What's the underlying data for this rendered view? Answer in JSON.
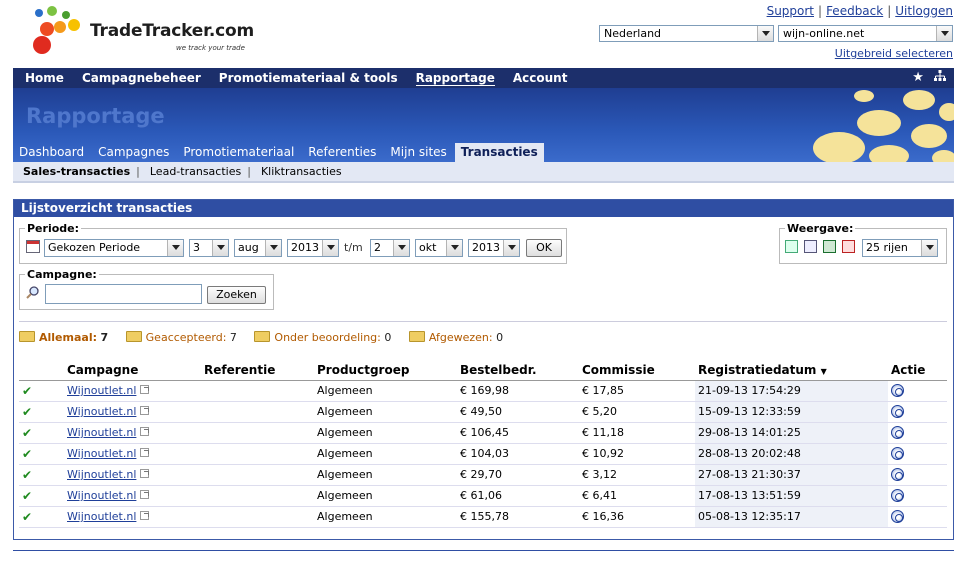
{
  "brand": {
    "name": "TradeTracker.com",
    "tagline": "we track your trade"
  },
  "top_links": [
    "Support",
    "Feedback",
    "Uitloggen"
  ],
  "country_select": {
    "value": "Nederland"
  },
  "site_select": {
    "value": "wijn-online.net"
  },
  "advanced_link": "Uitgebreid selecteren",
  "main_nav": [
    {
      "label": "Home",
      "active": false
    },
    {
      "label": "Campagnebeheer",
      "active": false
    },
    {
      "label": "Promotiemateriaal & tools",
      "active": false
    },
    {
      "label": "Rapportage",
      "active": true
    },
    {
      "label": "Account",
      "active": false
    }
  ],
  "main_nav_icons": [
    "star-icon",
    "sitemap-icon"
  ],
  "banner_title": "Rapportage",
  "sub_tabs": [
    {
      "label": "Dashboard",
      "active": false
    },
    {
      "label": "Campagnes",
      "active": false
    },
    {
      "label": "Promotiemateriaal",
      "active": false
    },
    {
      "label": "Referenties",
      "active": false
    },
    {
      "label": "Mijn sites",
      "active": false
    },
    {
      "label": "Transacties",
      "active": true
    }
  ],
  "sub_nav": [
    {
      "label": "Sales-transacties",
      "active": true
    },
    {
      "label": "Lead-transacties",
      "active": false
    },
    {
      "label": "Kliktransacties",
      "active": false
    }
  ],
  "panel": {
    "title": "Lijstoverzicht transacties",
    "periode": {
      "legend": "Periode:",
      "preset": "Gekozen Periode",
      "from_day": "3",
      "from_month": "aug",
      "from_year": "2013",
      "separator": "t/m",
      "to_day": "2",
      "to_month": "okt",
      "to_year": "2013",
      "ok_label": "OK"
    },
    "weergave": {
      "legend": "Weergave:",
      "export_icons": [
        "export-icon",
        "print-icon",
        "excel-icon",
        "pdf-icon"
      ],
      "rows": "25 rijen"
    },
    "campagne": {
      "legend": "Campagne:",
      "search_value": "",
      "search_label": "Zoeken"
    },
    "filters": [
      {
        "label": "Allemaal:",
        "count": "7",
        "active": true
      },
      {
        "label": "Geaccepteerd:",
        "count": "7",
        "active": false
      },
      {
        "label": "Onder beoordeling:",
        "count": "0",
        "active": false
      },
      {
        "label": "Afgewezen:",
        "count": "0",
        "active": false
      }
    ],
    "columns": [
      "Campagne",
      "Referentie",
      "Productgroep",
      "Bestelbedr.",
      "Commissie",
      "Registratiedatum",
      "Actie"
    ],
    "rows": [
      {
        "campagne": "Wijnoutlet.nl",
        "referentie": "",
        "productgroep": "Algemeen",
        "bestelbedr": "€ 169,98",
        "commissie": "€ 17,85",
        "datum": "21-09-13 17:54:29"
      },
      {
        "campagne": "Wijnoutlet.nl",
        "referentie": "",
        "productgroep": "Algemeen",
        "bestelbedr": "€ 49,50",
        "commissie": "€ 5,20",
        "datum": "15-09-13 12:33:59"
      },
      {
        "campagne": "Wijnoutlet.nl",
        "referentie": "",
        "productgroep": "Algemeen",
        "bestelbedr": "€ 106,45",
        "commissie": "€ 11,18",
        "datum": "29-08-13 14:01:25"
      },
      {
        "campagne": "Wijnoutlet.nl",
        "referentie": "",
        "productgroep": "Algemeen",
        "bestelbedr": "€ 104,03",
        "commissie": "€ 10,92",
        "datum": "28-08-13 20:02:48"
      },
      {
        "campagne": "Wijnoutlet.nl",
        "referentie": "",
        "productgroep": "Algemeen",
        "bestelbedr": "€ 29,70",
        "commissie": "€ 3,12",
        "datum": "27-08-13 21:30:37"
      },
      {
        "campagne": "Wijnoutlet.nl",
        "referentie": "",
        "productgroep": "Algemeen",
        "bestelbedr": "€ 61,06",
        "commissie": "€ 6,41",
        "datum": "17-08-13 13:51:59"
      },
      {
        "campagne": "Wijnoutlet.nl",
        "referentie": "",
        "productgroep": "Algemeen",
        "bestelbedr": "€ 155,78",
        "commissie": "€ 16,36",
        "datum": "05-08-13 12:35:17"
      }
    ]
  },
  "colors": {
    "nav_bg": "#1c2f6b",
    "banner": "#2b59b9",
    "accent_orange": "#b15a00",
    "link": "#1f3f99"
  }
}
